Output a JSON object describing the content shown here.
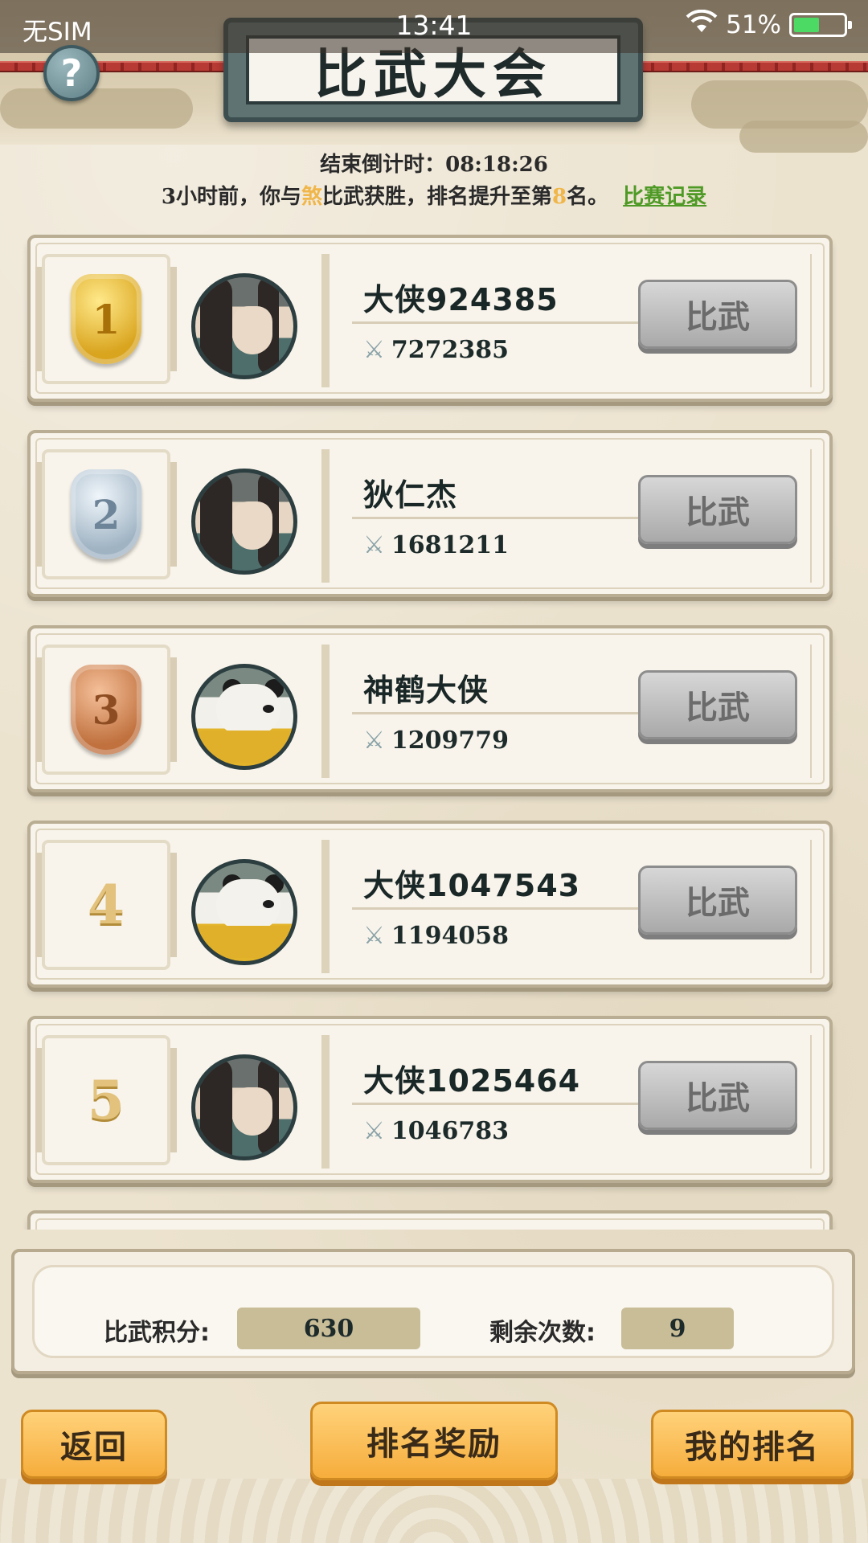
{
  "status_bar": {
    "carrier": "无SIM",
    "time": "13:41",
    "battery": "51%"
  },
  "header": {
    "title": "比武大会",
    "help": "?"
  },
  "info": {
    "countdown_label": "结束倒计时：",
    "countdown_value": "08:18:26",
    "news_prefix": "3小时前，你与",
    "news_opponent": "煞",
    "news_mid": "比武获胜，排名提升至第",
    "news_rank": "8",
    "news_suffix": "名。",
    "record_link": "比赛记录"
  },
  "rankings": [
    {
      "rank": "1",
      "medal": "gold",
      "avatar": "swordsman-avatar",
      "name": "大侠924385",
      "power": "7272385",
      "button": "比武"
    },
    {
      "rank": "2",
      "medal": "silver",
      "avatar": "swordsman-avatar",
      "name": "狄仁杰",
      "power": "1681211",
      "button": "比武"
    },
    {
      "rank": "3",
      "medal": "bronze",
      "avatar": "panda-avatar",
      "name": "神鹤大侠",
      "power": "1209779",
      "button": "比武"
    },
    {
      "rank": "4",
      "medal": "",
      "avatar": "panda-avatar",
      "name": "大侠1047543",
      "power": "1194058",
      "button": "比武"
    },
    {
      "rank": "5",
      "medal": "",
      "avatar": "swordsman-avatar",
      "name": "大侠1025464",
      "power": "1046783",
      "button": "比武"
    }
  ],
  "icons": {
    "power": "crossed-swords-icon",
    "help": "question-icon"
  },
  "stats": {
    "points_label": "比武积分:",
    "points_value": "630",
    "remaining_label": "剩余次数:",
    "remaining_value": "9"
  },
  "bottom": {
    "back": "返回",
    "rewards": "排名奖励",
    "my_rank": "我的排名"
  },
  "colors": {
    "accent_orange": "#f6ad3c",
    "link_green": "#4f9a26",
    "highlight": "#f0b64a"
  }
}
